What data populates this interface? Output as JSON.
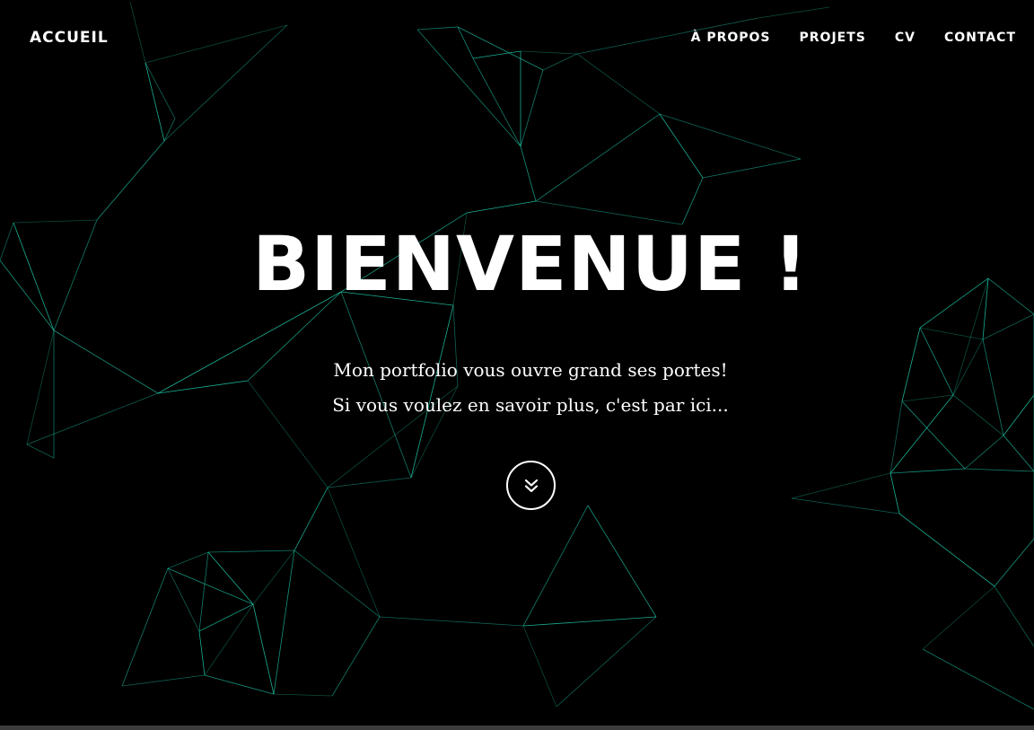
{
  "nav": {
    "brand": "ACCUEIL",
    "items": [
      {
        "label": "À PROPOS"
      },
      {
        "label": "PROJETS"
      },
      {
        "label": "CV"
      },
      {
        "label": "CONTACT"
      }
    ]
  },
  "hero": {
    "title": "BIENVENUE !",
    "line1": "Mon portfolio vous ouvre grand ses portes!",
    "line2": "Si vous voulez en savoir plus, c'est par ici..."
  },
  "scroll_button": {
    "icon": "double-chevron-down-icon"
  },
  "colors": {
    "background": "#000000",
    "text": "#ffffff",
    "network_accent": "#1fd1b0"
  }
}
